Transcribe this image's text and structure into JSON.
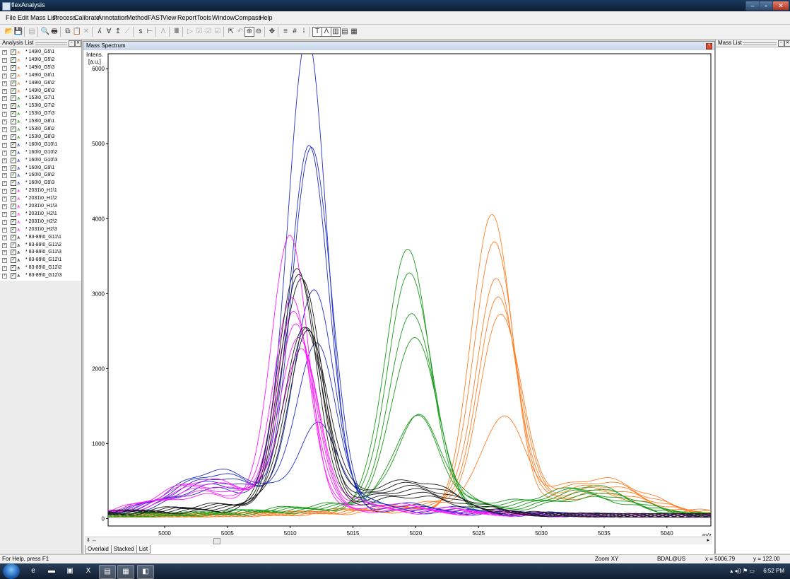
{
  "window": {
    "title": "flexAnalysis",
    "minimize": "–",
    "maximize": "▫",
    "close": "✕"
  },
  "menu": [
    "File",
    "Edit",
    "Mass List",
    "Process",
    "Calibrate",
    "Annotation",
    "Method",
    "FAST",
    "View",
    "Report",
    "Tools",
    "Window",
    "Compass",
    "Help"
  ],
  "toolbar_icons": [
    {
      "name": "open-icon",
      "glyph": "📂",
      "dim": false
    },
    {
      "name": "save-icon",
      "glyph": "💾",
      "dim": false
    },
    {
      "name": "sep"
    },
    {
      "name": "properties-icon",
      "glyph": "▤",
      "dim": true
    },
    {
      "name": "sep"
    },
    {
      "name": "print-preview-icon",
      "glyph": "🔍",
      "dim": false
    },
    {
      "name": "print-icon",
      "glyph": "🖶",
      "dim": false
    },
    {
      "name": "sep"
    },
    {
      "name": "copy-icon",
      "glyph": "⧉",
      "dim": false
    },
    {
      "name": "paste-icon",
      "glyph": "📋",
      "dim": true
    },
    {
      "name": "delete-icon",
      "glyph": "✕",
      "dim": true
    },
    {
      "name": "sep"
    },
    {
      "name": "smooth-icon",
      "glyph": "ʎ",
      "dim": false
    },
    {
      "name": "baseline-icon",
      "glyph": "Ɐ",
      "dim": false
    },
    {
      "name": "peak-find-icon",
      "glyph": "↥",
      "dim": false
    },
    {
      "name": "peak-edit-icon",
      "glyph": "⟋",
      "dim": true
    },
    {
      "name": "sep"
    },
    {
      "name": "mass-list-icon",
      "glyph": "ꜱ",
      "dim": false
    },
    {
      "name": "calibrate-icon",
      "glyph": "⊢",
      "dim": false
    },
    {
      "name": "sep"
    },
    {
      "name": "annotate-icon",
      "glyph": "Λ",
      "dim": true
    },
    {
      "name": "sep"
    },
    {
      "name": "label-icon",
      "glyph": "Ⅲ",
      "dim": false
    },
    {
      "name": "sep"
    },
    {
      "name": "run-icon",
      "glyph": "▷",
      "dim": true
    },
    {
      "name": "export-1-icon",
      "glyph": "☑",
      "dim": true
    },
    {
      "name": "export-2-icon",
      "glyph": "☑",
      "dim": true
    },
    {
      "name": "export-3-icon",
      "glyph": "☑",
      "dim": true
    },
    {
      "name": "sep"
    },
    {
      "name": "zoom-area-icon",
      "glyph": "⇱",
      "dim": false
    },
    {
      "name": "zoom-back-icon",
      "glyph": "↶",
      "dim": true
    },
    {
      "name": "zoom-in-icon",
      "glyph": "⊕",
      "dim": false,
      "selected": true
    },
    {
      "name": "zoom-out-icon",
      "glyph": "⊖",
      "dim": false
    },
    {
      "name": "sep"
    },
    {
      "name": "move-icon",
      "glyph": "✥",
      "dim": false
    },
    {
      "name": "sep"
    },
    {
      "name": "grid-a-icon",
      "glyph": "≡",
      "dim": false
    },
    {
      "name": "grid-b-icon",
      "glyph": "#",
      "dim": false
    },
    {
      "name": "grid-c-icon",
      "glyph": "⁞",
      "dim": false
    },
    {
      "name": "sep"
    },
    {
      "name": "view-text-icon",
      "glyph": "T",
      "dim": false,
      "selected": true
    },
    {
      "name": "view-overlay-icon",
      "glyph": "Λ",
      "dim": false,
      "selected": true
    },
    {
      "name": "view-stacked-icon",
      "glyph": "▥",
      "dim": false,
      "selected": true
    },
    {
      "name": "view-list-icon",
      "glyph": "▤",
      "dim": false
    },
    {
      "name": "view-table-icon",
      "glyph": "▦",
      "dim": false
    }
  ],
  "analysis_list": {
    "title": "Analysis List",
    "items": [
      {
        "label": "* 149\\0_G5\\1",
        "color": "#ff7f27"
      },
      {
        "label": "* 149\\0_G5\\2",
        "color": "#ff7f27"
      },
      {
        "label": "* 149\\0_G5\\3",
        "color": "#ff7f27"
      },
      {
        "label": "* 149\\0_G6\\1",
        "color": "#ff7f27"
      },
      {
        "label": "* 149\\0_G6\\2",
        "color": "#ff7f27"
      },
      {
        "label": "* 149\\0_G6\\3",
        "color": "#ff7f27"
      },
      {
        "label": "* 153\\0_G7\\1",
        "color": "#1a9a1a"
      },
      {
        "label": "* 153\\0_G7\\2",
        "color": "#1a9a1a"
      },
      {
        "label": "* 153\\0_G7\\3",
        "color": "#1a9a1a"
      },
      {
        "label": "* 153\\0_G8\\1",
        "color": "#1a9a1a"
      },
      {
        "label": "* 153\\0_G8\\2",
        "color": "#1a9a1a"
      },
      {
        "label": "* 153\\0_G8\\3",
        "color": "#1a9a1a"
      },
      {
        "label": "* 160\\0_G10\\1",
        "color": "#1f2fc8"
      },
      {
        "label": "* 160\\0_G10\\2",
        "color": "#1f2fc8"
      },
      {
        "label": "* 160\\0_G10\\3",
        "color": "#1f2fc8"
      },
      {
        "label": "* 160\\0_G9\\1",
        "color": "#1f2fc8"
      },
      {
        "label": "* 160\\0_G9\\2",
        "color": "#1f2fc8"
      },
      {
        "label": "* 160\\0_G9\\3",
        "color": "#1f2fc8"
      },
      {
        "label": "* 2031\\0_H1\\1",
        "color": "#ff19ff"
      },
      {
        "label": "* 2031\\0_H1\\2",
        "color": "#ff19ff"
      },
      {
        "label": "* 2031\\0_H1\\3",
        "color": "#ff19ff"
      },
      {
        "label": "* 2031\\0_H2\\1",
        "color": "#ff19ff"
      },
      {
        "label": "* 2031\\0_H2\\2",
        "color": "#ff19ff"
      },
      {
        "label": "* 2031\\0_H2\\3",
        "color": "#ff19ff"
      },
      {
        "label": "* 83-89\\0_G11\\1",
        "color": "#222222"
      },
      {
        "label": "* 83-89\\0_G11\\2",
        "color": "#222222"
      },
      {
        "label": "* 83-89\\0_G11\\3",
        "color": "#222222"
      },
      {
        "label": "* 83-89\\0_G12\\1",
        "color": "#222222"
      },
      {
        "label": "* 83-89\\0_G12\\2",
        "color": "#222222"
      },
      {
        "label": "* 83-89\\0_G12\\3",
        "color": "#222222"
      }
    ]
  },
  "spectrum": {
    "title": "Mass Spectrum",
    "tabs": [
      "Overlaid",
      "Stacked",
      "List"
    ]
  },
  "chart_data": {
    "type": "line",
    "ylabel_line1": "Intens.",
    "ylabel_line2": "[a.u.]",
    "xlabel": "m/z",
    "xlim": [
      4995.5,
      5043.5
    ],
    "ylim": [
      -100,
      6200
    ],
    "xticks": [
      5000,
      5005,
      5010,
      5015,
      5020,
      5025,
      5030,
      5035,
      5040
    ],
    "yticks": [
      0,
      1000,
      2000,
      3000,
      4000,
      5000,
      6000
    ],
    "groups": [
      {
        "id": "149",
        "color": "#ff7f27",
        "center": 5026.6,
        "sigma": 1.6,
        "heights": [
          3950,
          3530,
          3000,
          2750,
          2520,
          1120
        ],
        "shoulder": [
          5035,
          320
        ]
      },
      {
        "id": "153",
        "color": "#1a9a1a",
        "center": 5019.7,
        "sigma": 1.75,
        "heights": [
          3450,
          3120,
          2580,
          2240,
          1150,
          1120
        ],
        "shoulder": [
          5034,
          300
        ]
      },
      {
        "id": "160",
        "color": "#1f2fc8",
        "center": 5011.9,
        "sigma": 1.55,
        "heights": [
          6280,
          4800,
          4780,
          2860,
          2100,
          1000
        ],
        "shoulder": [
          5004,
          420
        ]
      },
      {
        "id": "2031",
        "color": "#ff19ff",
        "center": 5010.3,
        "sigma": 1.45,
        "heights": [
          3640,
          2760,
          2560,
          2400,
          2200,
          2000
        ],
        "shoulder": [
          5003,
          300
        ]
      },
      {
        "id": "83-89",
        "color": "#1a1a1a",
        "center": 5011.1,
        "sigma": 1.55,
        "heights": [
          3190,
          3110,
          3050,
          2360,
          2300,
          2240
        ],
        "shoulder": [
          5020,
          300
        ]
      }
    ]
  },
  "mass_list_panel": {
    "title": "Mass List"
  },
  "statusbar": {
    "help": "For Help, press F1",
    "zoom": "Zoom XY",
    "user": "BDAL@US",
    "x": "x = 5006.79",
    "y": "y = 122.00"
  },
  "taskbar": {
    "time": "6:52 PM",
    "apps": [
      {
        "name": "ie-icon",
        "glyph": "e"
      },
      {
        "name": "explorer-icon",
        "glyph": "▬"
      },
      {
        "name": "app-icon",
        "glyph": "▣"
      },
      {
        "name": "excel-icon",
        "glyph": "X"
      },
      {
        "name": "app2-icon",
        "glyph": "▤"
      },
      {
        "name": "app3-icon",
        "glyph": "▦"
      },
      {
        "name": "flexanalysis-icon",
        "glyph": "◧"
      }
    ]
  }
}
